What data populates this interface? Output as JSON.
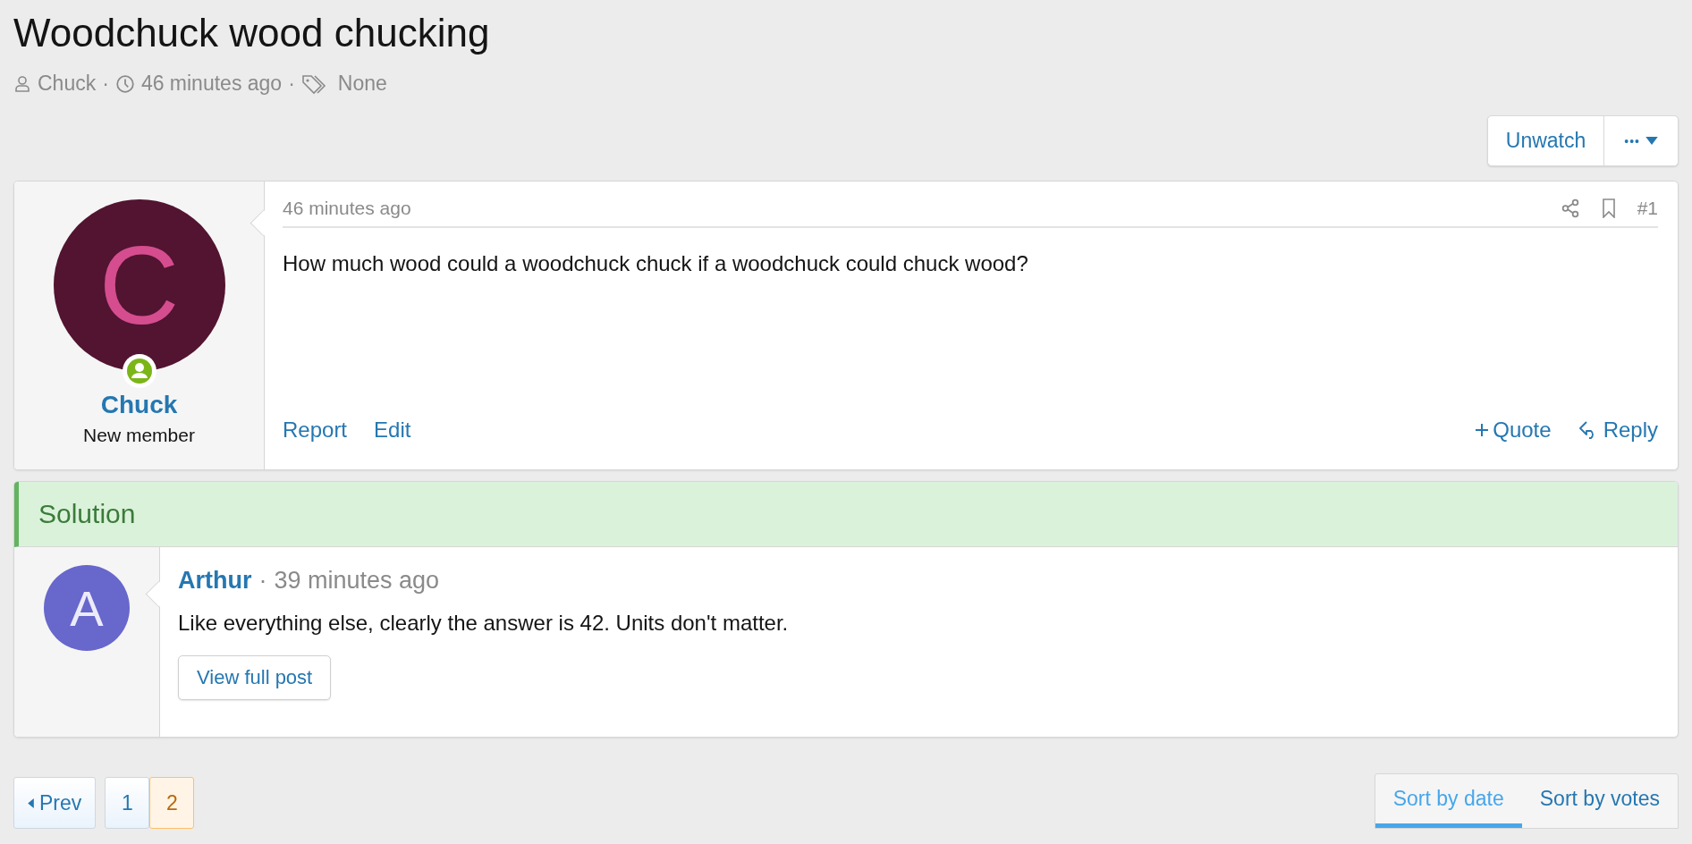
{
  "thread": {
    "title": "Woodchuck wood chucking",
    "author": "Chuck",
    "separator_1": "·",
    "time": "46 minutes ago",
    "separator_2": "·",
    "tags": "None"
  },
  "thread_actions": {
    "watch": "Unwatch",
    "more": "•••"
  },
  "post": {
    "time": "46 minutes ago",
    "number": "#1",
    "avatar_letter": "C",
    "author": "Chuck",
    "role": "New member",
    "body": "How much wood could a woodchuck chuck if a woodchuck could chuck wood?",
    "left_actions": [
      "Report",
      "Edit"
    ],
    "quote": "Quote",
    "reply": "Reply"
  },
  "solution": {
    "label": "Solution",
    "avatar_letter": "A",
    "author": "Arthur",
    "separator": "·",
    "time": "39 minutes ago",
    "body": "Like everything else, clearly the answer is 42. Units don't matter.",
    "button": "View full post"
  },
  "pagination": {
    "prev": "Prev",
    "pages": [
      {
        "label": "1",
        "selected": false
      },
      {
        "label": "2",
        "selected": true
      }
    ]
  },
  "sort": [
    {
      "label": "Sort by date",
      "selected": true
    },
    {
      "label": "Sort by votes",
      "selected": false
    }
  ]
}
